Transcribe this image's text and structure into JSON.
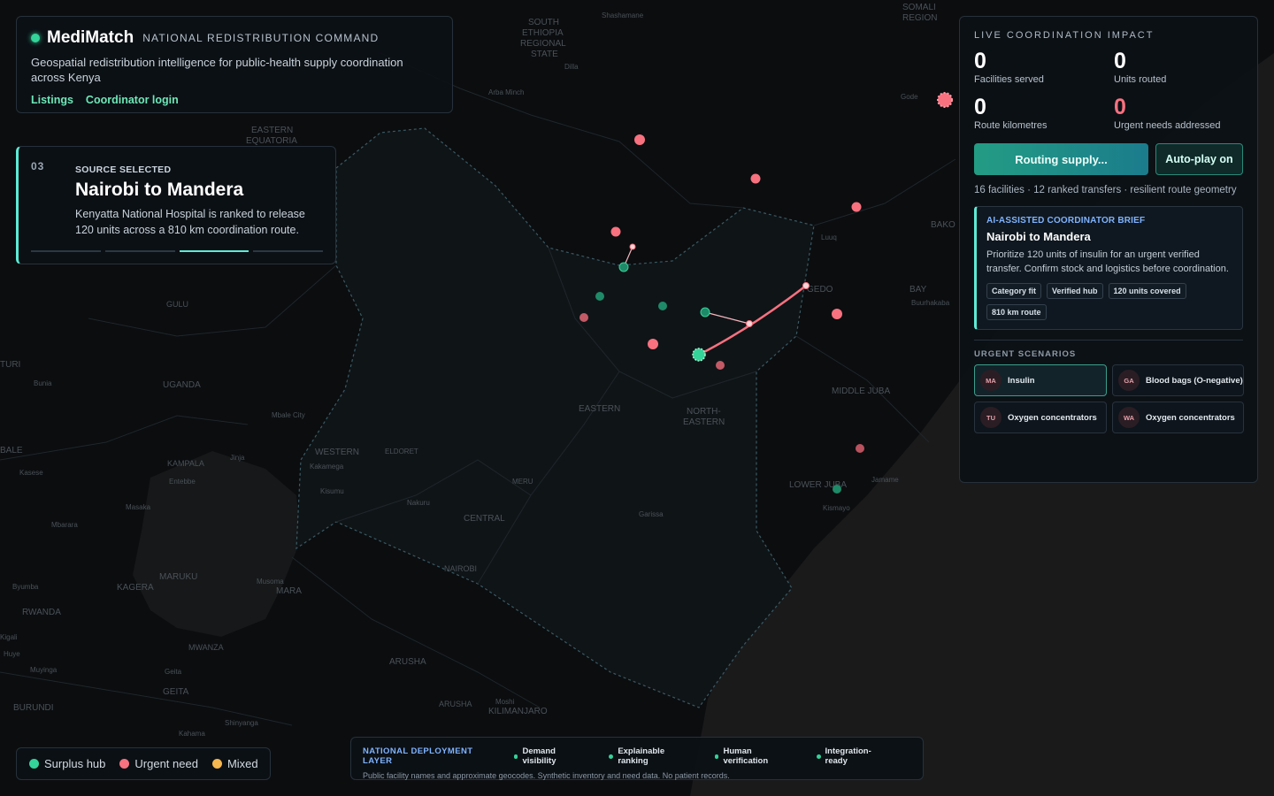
{
  "header": {
    "brand": "MediMatch",
    "subtitle": "NATIONAL REDISTRIBUTION COMMAND",
    "description": "Geospatial redistribution intelligence for public-health supply coordination across Kenya",
    "links": [
      "Listings",
      "Coordinator login"
    ]
  },
  "step": {
    "number": "03",
    "kicker": "SOURCE SELECTED",
    "title": "Nairobi to Mandera",
    "description": "Kenyatta National Hospital is ranked to release 120 units across a 810 km coordination route.",
    "progress_total": 4,
    "progress_active": 3
  },
  "impact": {
    "title": "LIVE COORDINATION IMPACT",
    "metrics": [
      {
        "value": "0",
        "label": "Facilities served"
      },
      {
        "value": "0",
        "label": "Units routed"
      },
      {
        "value": "0",
        "label": "Route kilometres"
      },
      {
        "value": "0",
        "label": "Urgent needs addressed"
      }
    ],
    "primary_button": "Routing supply...",
    "secondary_button": "Auto-play on",
    "note": "16 facilities · 12 ranked transfers · resilient route geometry",
    "brief": {
      "kicker": "AI-ASSISTED COORDINATOR BRIEF",
      "title": "Nairobi to Mandera",
      "text": "Prioritize 120 units of insulin for an urgent verified transfer. Confirm stock and logistics before coordination.",
      "tags": [
        "Category fit",
        "Verified hub",
        "120 units covered",
        "810 km route"
      ]
    },
    "scenarios_title": "URGENT SCENARIOS",
    "scenarios": [
      {
        "initials": "MA",
        "label": "Insulin",
        "active": true
      },
      {
        "initials": "GA",
        "label": "Blood bags (O-negative)",
        "active": false
      },
      {
        "initials": "TU",
        "label": "Oxygen concentrators",
        "active": false
      },
      {
        "initials": "WA",
        "label": "Oxygen concentrators",
        "active": false
      }
    ]
  },
  "legend": [
    {
      "label": "Surplus hub",
      "color": "#34d399"
    },
    {
      "label": "Urgent need",
      "color": "#f8717f"
    },
    {
      "label": "Mixed",
      "color": "#f5b74f"
    }
  ],
  "footer": {
    "kicker": "NATIONAL DEPLOYMENT LAYER",
    "items": [
      "Demand visibility",
      "Explainable ranking",
      "Human verification",
      "Integration-ready"
    ],
    "note": "Public facility names and approximate geocodes. Synthetic inventory and need data. No patient records."
  },
  "map": {
    "labels": [
      "SOUTH ETHIOPIA REGIONAL STATE",
      "Shashamane",
      "SOMALI REGION",
      "Dilla",
      "Arba Minch",
      "Gode",
      "EASTERN EQUATORIA",
      "Luuq",
      "BAKO",
      "BAY",
      "Buurhakaba",
      "GEDO",
      "GULU",
      "TURI",
      "Bunia",
      "UGANDA",
      "Mbale City",
      "MIDDLE JUBA",
      "EASTERN",
      "NORTH-EASTERN",
      "WESTERN",
      "ELDORET",
      "KAMPALA",
      "Jinja",
      "Kakamega",
      "Kasese",
      "Entebbe",
      "Kisumu",
      "MERU",
      "LOWER JUBA",
      "Jamame",
      "Kismayo",
      "Masaka",
      "Nakuru",
      "Mbarara",
      "CENTRAL",
      "Garissa",
      "NAIROBI",
      "MARUKU",
      "KAGERA",
      "Musoma",
      "MARA",
      "RWANDA",
      "Byumba",
      "Kigali",
      "Huye",
      "Muyinga",
      "MWANZA",
      "Geita",
      "ARUSHA",
      "GEITA",
      "BURUNDI",
      "Moshi",
      "ARUSHA",
      "KILIMANJARO",
      "Shinyanga",
      "Kahama",
      "BALE"
    ]
  },
  "colors": {
    "surplus": "#34d399",
    "urgent": "#f8717f",
    "mixed": "#f5b74f",
    "accent": "#5eead4"
  }
}
